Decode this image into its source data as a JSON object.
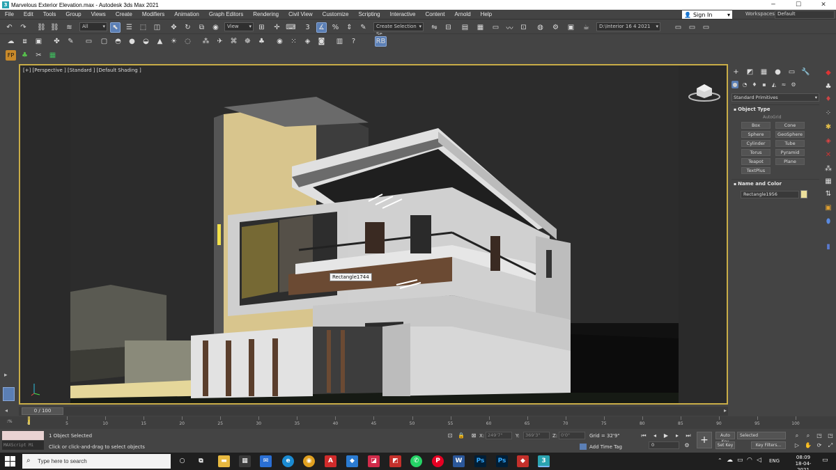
{
  "window": {
    "title": "Marvelous Exterior Elevation.max - Autodesk 3ds Max 2021",
    "app_icon": "3"
  },
  "menu": {
    "items": [
      "File",
      "Edit",
      "Tools",
      "Group",
      "Views",
      "Create",
      "Modifiers",
      "Animation",
      "Graph Editors",
      "Rendering",
      "Civil View",
      "Customize",
      "Scripting",
      "Interactive",
      "Content",
      "Arnold",
      "Help"
    ],
    "sign_in": "Sign In",
    "workspaces_label": "Workspaces:",
    "workspace_value": "Default"
  },
  "toolbar": {
    "filter_value": "All",
    "coord_system": "View",
    "selection_set_placeholder": "Create Selection Se",
    "project_path": "D:\\Interior 16 4 2021",
    "rb_label": "RB"
  },
  "viewport": {
    "label": "[+] [Perspective ] [Standard ] [Default Shading ]",
    "tooltip": "Rectangle1744"
  },
  "command_panel": {
    "category": "Standard Primitives",
    "object_type_header": "Object Type",
    "autogrid": "AutoGrid",
    "primitives": [
      "Box",
      "Cone",
      "Sphere",
      "GeoSphere",
      "Cylinder",
      "Tube",
      "Torus",
      "Pyramid",
      "Teapot",
      "Plane",
      "TextPlus"
    ],
    "name_color_header": "Name and Color",
    "object_name": "Rectangle1956",
    "object_color": "#ecdf9c"
  },
  "timeline": {
    "slider_label": "0 / 100",
    "ticks": [
      "0",
      "5",
      "10",
      "15",
      "20",
      "25",
      "30",
      "35",
      "40",
      "45",
      "50",
      "55",
      "60",
      "65",
      "70",
      "75",
      "80",
      "85",
      "90",
      "95",
      "100"
    ]
  },
  "status": {
    "maxscript_label": "MAXScript Mi",
    "selection_info": "1 Object Selected",
    "prompt": "Click or click-and-drag to select objects",
    "x_label": "X:",
    "x_value": "249'7\"",
    "y_label": "Y:",
    "y_value": "369'3\"",
    "z_label": "Z:",
    "z_value": "0'0\"",
    "grid": "Grid = 32'9\"",
    "add_time_tag": "Add Time Tag",
    "frame_value": "0",
    "auto_key": "Auto Key",
    "set_key": "Set Key",
    "key_mode": "Selected",
    "key_filters": "Key Filters..."
  },
  "taskbar": {
    "search_placeholder": "Type here to search",
    "language": "ENG",
    "time": "08:09",
    "date": "18-04-2021"
  },
  "colors": {
    "viewport_border": "#c9ad47",
    "accent_blue": "#5b7fb5"
  }
}
